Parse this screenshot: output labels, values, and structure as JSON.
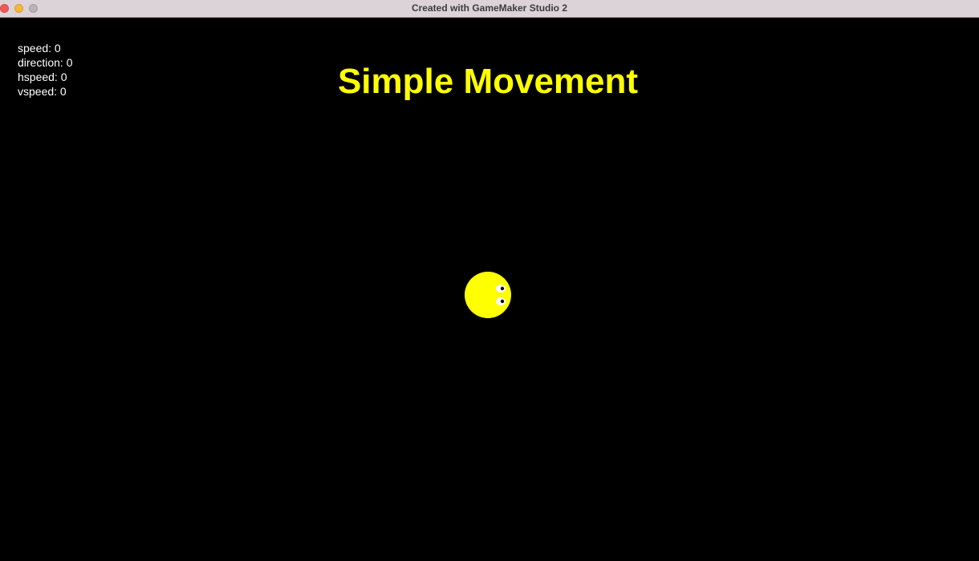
{
  "window": {
    "title": "Created with GameMaker Studio 2"
  },
  "hud": {
    "speed_label": "speed: 0",
    "direction_label": "direction: 0",
    "hspeed_label": "hspeed: 0",
    "vspeed_label": "vspeed: 0"
  },
  "game": {
    "title": "Simple Movement",
    "colors": {
      "background": "#000000",
      "title": "#ffff00",
      "player": "#ffff00",
      "hud_text": "#ffffff"
    }
  },
  "icons": {
    "player": "yellow-ball-with-eyes-sprite"
  }
}
